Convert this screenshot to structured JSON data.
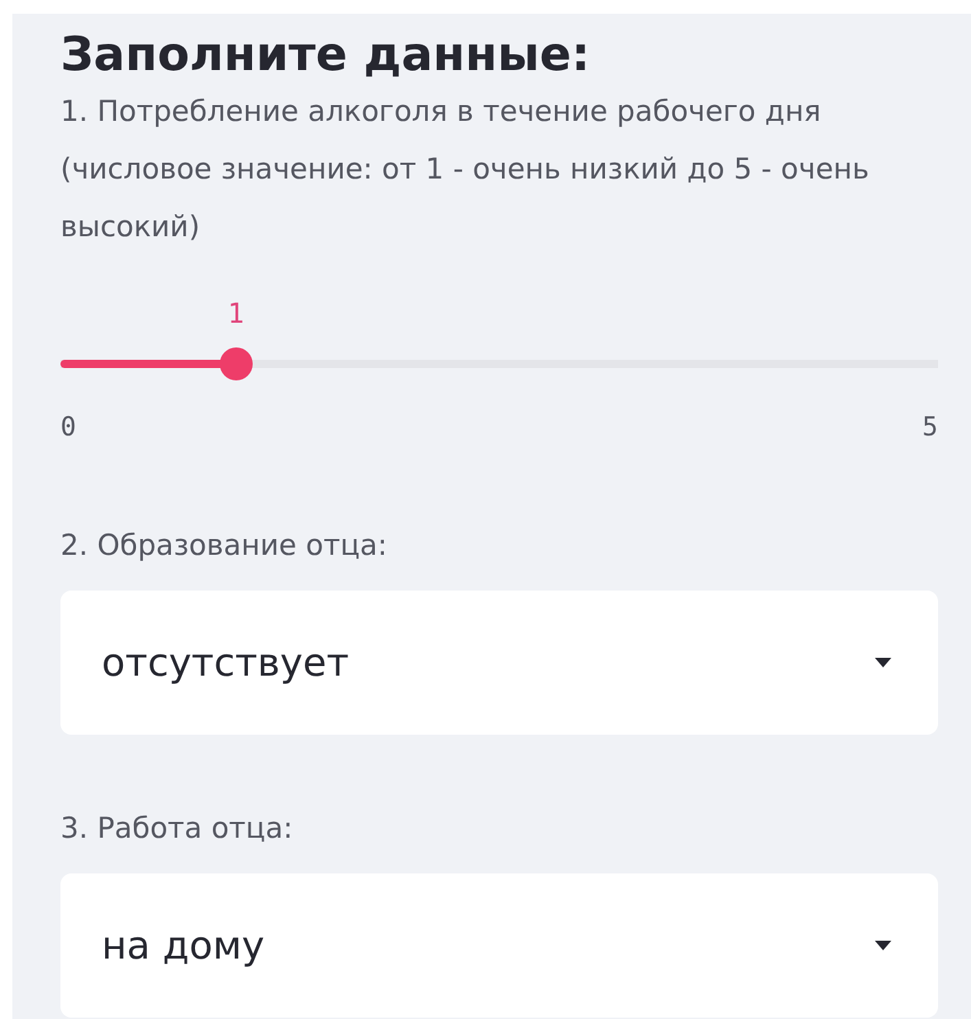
{
  "heading": "Заполните данные:",
  "slider": {
    "label": "1. Потребление алкоголя в течение рабочего дня (числовое значение: от 1 - очень низкий до 5 - очень высокий)",
    "value": "1",
    "min": "0",
    "max": "5",
    "level": 0.2
  },
  "selects": [
    {
      "label": "2. Образование отца:",
      "value": "отсутствует"
    },
    {
      "label": "3. Работа отца:",
      "value": "на дому"
    }
  ]
}
